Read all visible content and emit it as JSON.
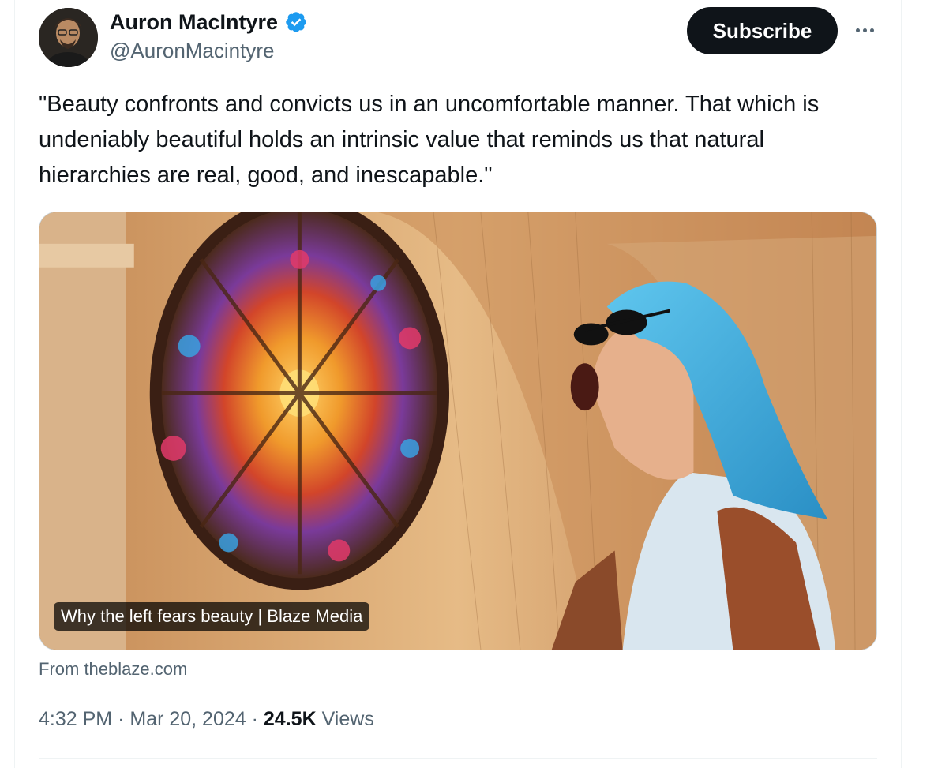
{
  "author": {
    "display_name": "Auron MacIntyre",
    "handle": "@AuronMacintyre",
    "verified": true
  },
  "actions": {
    "subscribe_label": "Subscribe",
    "more_icon": "more-horizontal-icon"
  },
  "tweet": {
    "text": "\"Beauty confronts and convicts us in an uncomfortable manner. That which is undeniably beautiful holds an intrinsic value that reminds us that natural hierarchies are real, good, and inescapable.\""
  },
  "link_card": {
    "caption": "Why the left fears beauty | Blaze Media",
    "source": "From theblaze.com"
  },
  "meta": {
    "time": "4:32 PM",
    "separator": "·",
    "date": "Mar 20, 2024",
    "views_count": "24.5K",
    "views_label": "Views"
  },
  "colors": {
    "text_primary": "#0f1419",
    "text_secondary": "#536471",
    "verified_blue": "#1d9bf0",
    "button_bg": "#0f1419"
  }
}
